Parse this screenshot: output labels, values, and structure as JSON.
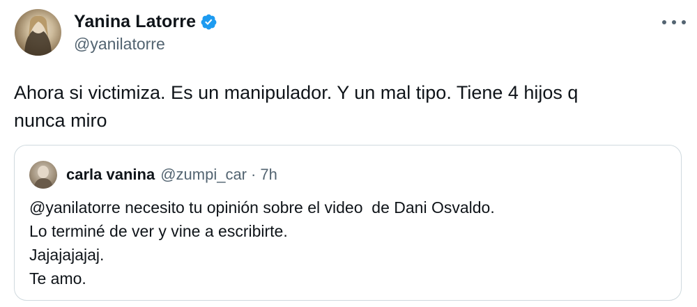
{
  "author": {
    "display_name": "Yanina Latorre",
    "handle": "@yanilatorre",
    "verified": true,
    "verified_color": "#1d9bf0"
  },
  "tweet": {
    "text_line1": "Ahora si victimiza. Es un manipulador. Y un mal tipo. Tiene 4 hijos q",
    "text_line2": "nunca miro"
  },
  "menu": {
    "icon": "more-horizontal-icon"
  },
  "quote": {
    "display_name": "carla vanina",
    "handle": "@zumpi_car",
    "separator": "·",
    "time": "7h",
    "lines": [
      "@yanilatorre necesito tu opinión sobre el video  de Dani Osvaldo.",
      "Lo terminé de ver y vine a escribirte.",
      "Jajajajajaj.",
      "Te amo."
    ]
  },
  "colors": {
    "text": "#0f1419",
    "secondary": "#536471",
    "border": "#cfd9de"
  }
}
